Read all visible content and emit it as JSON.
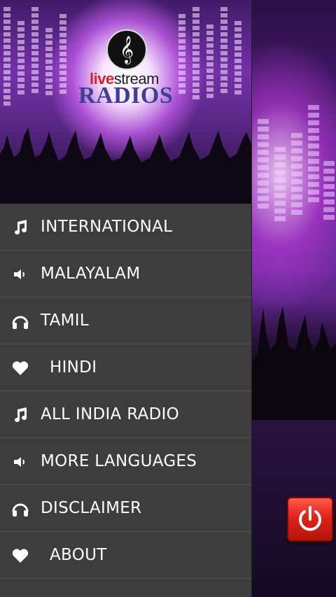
{
  "app": {
    "logo_text_live": "live",
    "logo_text_stream": "stream",
    "logo_text_radios": "RADIOS",
    "logo_icon": "treble-clef-icon"
  },
  "menu": {
    "items": [
      {
        "label": "INTERNATIONAL",
        "icon": "music-note-icon"
      },
      {
        "label": "MALAYALAM",
        "icon": "speaker-icon"
      },
      {
        "label": "TAMIL",
        "icon": "headphones-icon"
      },
      {
        "label": "HINDI",
        "icon": "heart-icon"
      },
      {
        "label": "ALL INDIA RADIO",
        "icon": "music-note-icon"
      },
      {
        "label": "MORE LANGUAGES",
        "icon": "speaker-icon"
      },
      {
        "label": "DISCLAIMER",
        "icon": "headphones-icon"
      },
      {
        "label": "ABOUT",
        "icon": "heart-icon"
      }
    ]
  },
  "power_button": {
    "icon": "power-icon",
    "color": "#e0231a"
  },
  "colors": {
    "drawer_bg": "#3d3d3d",
    "brand_blue": "#3b3f96",
    "brand_red": "#d1232a"
  }
}
